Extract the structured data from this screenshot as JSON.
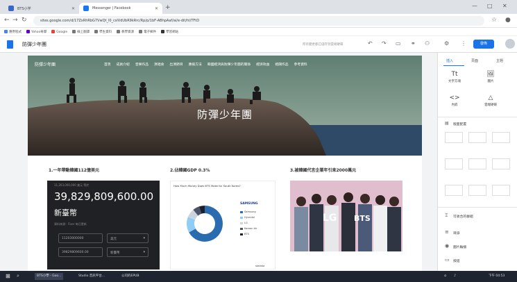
{
  "browser": {
    "tabs": [
      {
        "title": "BTS小学",
        "active": false
      },
      {
        "title": "Messenger | Facebook",
        "active": true
      }
    ],
    "url": "sites.google.com/d/17ZxRhRbG7VwQt_l0_cslVdUbR9kRrc/Rp/p/1bF-ABhpAaf/ai/e-dit/hl/TFtD",
    "bookmarks": [
      "應用程式",
      "Yahoo奇摩",
      "Google",
      "線上翻譯",
      "學生資料",
      "教學資源",
      "電子郵件",
      "學習網站"
    ]
  },
  "editor": {
    "title": "防彈少年團",
    "save_status": "所有變更都已儲存到雲端硬碟",
    "publish_label": "發佈"
  },
  "site": {
    "logo": "防彈少年團",
    "nav": [
      "首頁",
      "成員介紹",
      "音樂作品",
      "演唱會",
      "出演節目",
      "應援方法",
      "韓國經濟與防彈少年團的關係",
      "經濟效益",
      "相關作品",
      "參考資料"
    ],
    "banner_title": "防彈少年團"
  },
  "sections": {
    "s1_title": "1.一年帶動韓國112億美元",
    "s2_title": "2.佔韓國GDP 0.3%",
    "s3_title": "3.被韓國代言企業年引來2000萬元"
  },
  "calculator": {
    "subtitle": "11,203,000,000 美元 等於",
    "amount": "39,829,809,600.00",
    "unit": "新臺幣",
    "rate_note": "資料來源：Fixer 每日更新",
    "field1_value": "11203000000",
    "field1_unit": "美元",
    "field2_value": "39829809600.00",
    "field2_unit": "新臺幣"
  },
  "gdp_chart": {
    "title": "How Much Money Does BTS Make for South Korea?",
    "brand": "SAMSUNG",
    "legend": [
      "Samsung",
      "Hyundai",
      "LG",
      "Korean Air",
      "BTS"
    ],
    "source": "statista",
    "colors": [
      "#2b6cb0",
      "#90cdf4",
      "#cbd5e0",
      "#4a5568",
      "#1a202c"
    ],
    "values": [
      67,
      14,
      8,
      6,
      5
    ]
  },
  "photo": {
    "lg_label": "LG",
    "bts_label": "BTS"
  },
  "panel": {
    "tabs": [
      "插入",
      "頁面",
      "主題"
    ],
    "insert_items": [
      {
        "label": "文字方塊",
        "icon": "Tt"
      },
      {
        "label": "圖片",
        "icon": "🖼"
      },
      {
        "label": "內嵌",
        "icon": "<>"
      },
      {
        "label": "雲端硬碟",
        "icon": "△"
      }
    ],
    "layouts_title": "版面配置",
    "list_items": [
      "可收合的群組",
      "目錄",
      "圖片輪播",
      "按鈕"
    ]
  },
  "taskbar": {
    "items": [
      "BTS小學 - Goo...",
      "Studio 音訊平台...",
      "公司的EPUB"
    ],
    "clock": "下午 04:53"
  }
}
